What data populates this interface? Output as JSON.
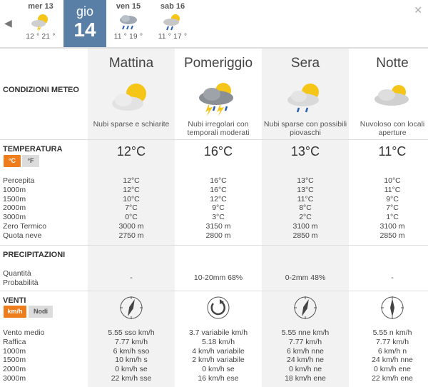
{
  "days": [
    {
      "name": "mer 13",
      "temps": "12 ° 21 °",
      "icon": "sun-storm-icon"
    },
    {
      "name": "gio",
      "num": "14",
      "icon": "",
      "selected": true
    },
    {
      "name": "ven 15",
      "temps": "11 ° 19 °",
      "icon": "cloud-rain-icon"
    },
    {
      "name": "sab 16",
      "temps": "11 ° 17 °",
      "icon": "cloud-sun-rain-icon"
    }
  ],
  "periods": [
    "Mattina",
    "Pomeriggio",
    "Sera",
    "Notte"
  ],
  "conditions": {
    "label": "CONDIZIONI METEO",
    "items": [
      {
        "text": "Nubi sparse e schiarite",
        "icon": "partly-cloudy-icon"
      },
      {
        "text": "Nubi irregolari con temporali moderati",
        "icon": "thunderstorm-icon"
      },
      {
        "text": "Nubi sparse con possibili piovaschi",
        "icon": "cloud-showers-icon"
      },
      {
        "text": "Nuvoloso con locali aperture",
        "icon": "cloudy-icon"
      }
    ]
  },
  "temperature": {
    "label": "TEMPERATURA",
    "unit_c": "°C",
    "unit_f": "°F",
    "values": [
      "12°C",
      "16°C",
      "13°C",
      "11°C"
    ],
    "rows": [
      "Percepita",
      "1000m",
      "1500m",
      "2000m",
      "3000m",
      "Zero Termico",
      "Quota neve"
    ],
    "cols": [
      [
        "12°C",
        "12°C",
        "10°C",
        "7°C",
        "0°C",
        "3000 m",
        "2750 m"
      ],
      [
        "16°C",
        "16°C",
        "12°C",
        "9°C",
        "3°C",
        "3150 m",
        "2800 m"
      ],
      [
        "13°C",
        "13°C",
        "11°C",
        "8°C",
        "2°C",
        "3100 m",
        "2850 m"
      ],
      [
        "10°C",
        "11°C",
        "9°C",
        "7°C",
        "1°C",
        "3100 m",
        "2850 m"
      ]
    ]
  },
  "precipitation": {
    "label": "PRECIPITAZIONI",
    "rows": [
      "Quantità",
      "Probabilità"
    ],
    "values": [
      "-",
      "10-20mm 68%",
      "0-2mm 48%",
      "-"
    ]
  },
  "wind": {
    "label": "VENTI",
    "unit_kmh": "km/h",
    "unit_knots": "Nodi",
    "rows": [
      "Vento medio",
      "Raffica",
      "1000m",
      "1500m",
      "2000m",
      "3000m"
    ],
    "directions_deg": [
      202,
      null,
      22,
      0
    ],
    "cols": [
      [
        "5.55 sso km/h",
        "7.77 km/h",
        "6 km/h sso",
        "10 km/h s",
        "0 km/h se",
        "22 km/h sse"
      ],
      [
        "3.7 variabile km/h",
        "5.18 km/h",
        "4 km/h variabile",
        "2 km/h variabile",
        "0 km/h se",
        "16 km/h ese"
      ],
      [
        "5.55 nne km/h",
        "7.77 km/h",
        "6 km/h nne",
        "24 km/h ne",
        "0 km/h ne",
        "18 km/h ene"
      ],
      [
        "5.55 n km/h",
        "7.77 km/h",
        "6 km/h n",
        "24 km/h nne",
        "0 km/h ene",
        "22 km/h ene"
      ]
    ]
  }
}
